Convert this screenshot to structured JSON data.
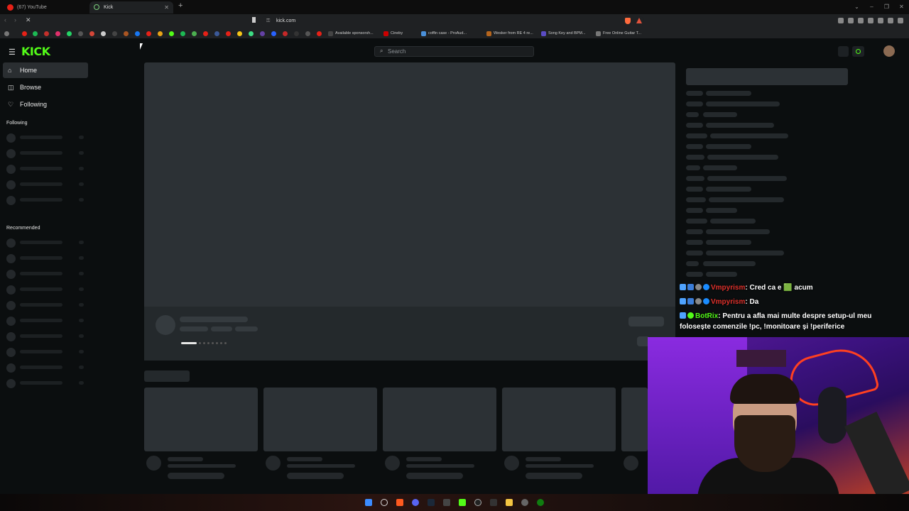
{
  "browser": {
    "tabs": [
      {
        "title": "(67) YouTube"
      },
      {
        "title": "Kick"
      }
    ],
    "url": "kick.com",
    "bookmarks": [
      "Available sponsorsh...",
      "Cineby",
      "coffin case - ProAud...",
      "Wesker from RE 4 re...",
      "Song Key and BPM...",
      "Free Online Guitar T..."
    ]
  },
  "header": {
    "logo": "KICK",
    "search_placeholder": "Search"
  },
  "sidebar": {
    "nav": [
      {
        "label": "Home",
        "icon": "home-icon",
        "active": true
      },
      {
        "label": "Browse",
        "icon": "compass-icon"
      },
      {
        "label": "Following",
        "icon": "heart-icon"
      }
    ],
    "following_label": "Following",
    "recommended_label": "Recommended"
  },
  "chat": {
    "messages": [
      {
        "user": "Vmpyrism",
        "text": "Cred ca e 🟩 acum"
      },
      {
        "user": "Vmpyrism",
        "text": "Da"
      },
      {
        "user": "BotRix",
        "text": "Pentru a afla mai multe despre setup-ul meu",
        "text2": "folosește comenzile !pc, !monitoare și !periferice"
      }
    ]
  },
  "colors": {
    "brand": "#53fc18",
    "chat_user": "#e0312b"
  }
}
